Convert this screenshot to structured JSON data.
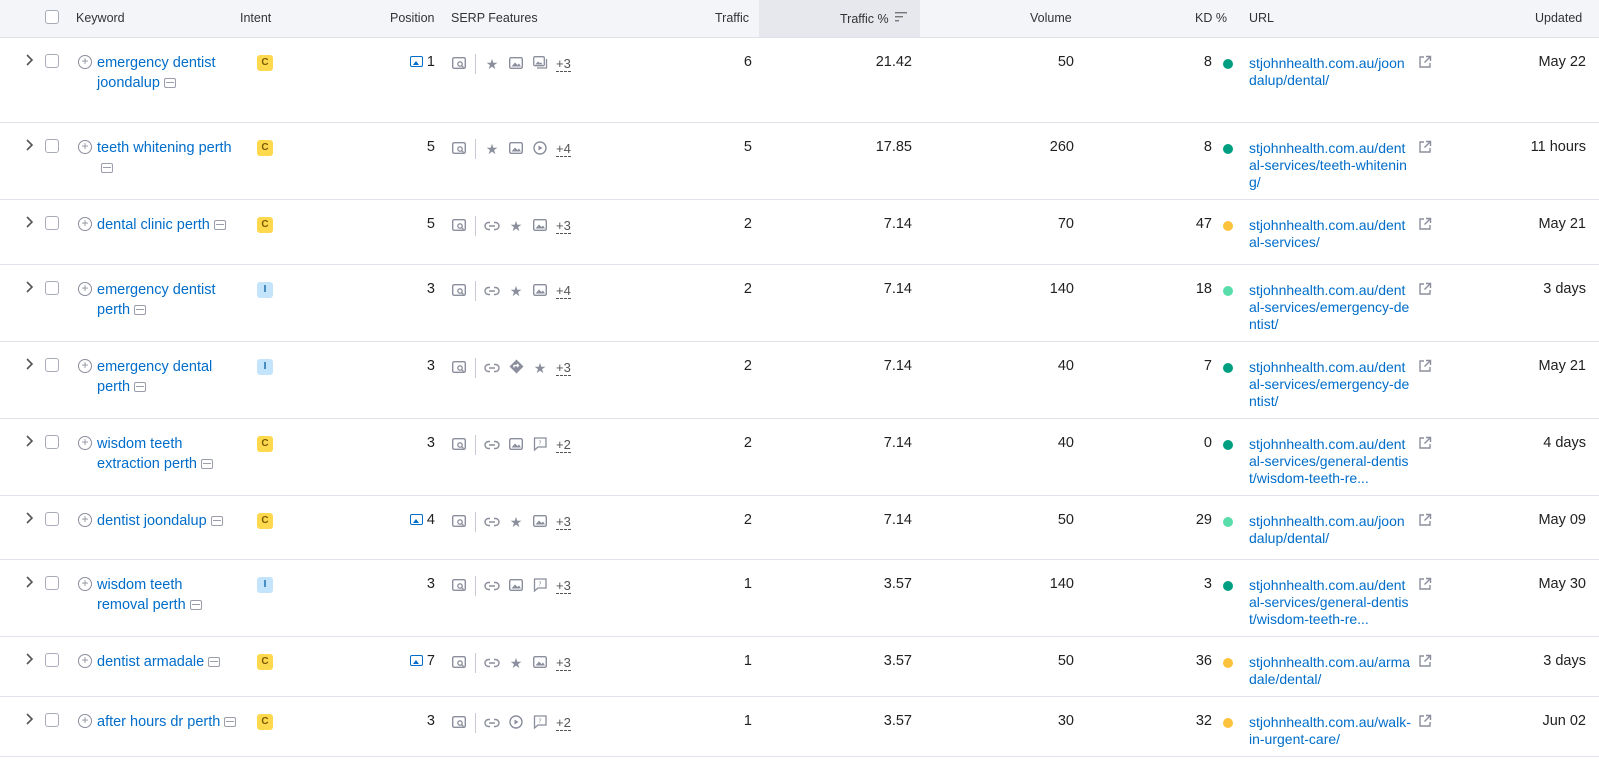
{
  "headers": {
    "keyword": "Keyword",
    "intent": "Intent",
    "position": "Position",
    "serp_features": "SERP Features",
    "traffic": "Traffic",
    "traffic_pct": "Traffic %",
    "volume": "Volume",
    "kd": "KD %",
    "url": "URL",
    "updated": "Updated"
  },
  "rows": [
    {
      "keyword": "emergency dentist joondalup",
      "intent": "C",
      "position_icon": true,
      "position": "1",
      "features": [
        "serp-snippet-icon",
        "star-icon",
        "image-icon",
        "image-pack-icon"
      ],
      "more": "+3",
      "traffic": "6",
      "traffic_pct": "21.42",
      "volume": "50",
      "kd": "8",
      "kd_color": "#009f81",
      "url": "stjohnhealth.com.au/joondalup/dental/",
      "updated": "May 22"
    },
    {
      "keyword": "teeth whitening perth",
      "intent": "C",
      "position_icon": false,
      "position": "5",
      "features": [
        "serp-snippet-icon",
        "star-icon",
        "image-icon",
        "video-icon"
      ],
      "more": "+4",
      "traffic": "5",
      "traffic_pct": "17.85",
      "volume": "260",
      "kd": "8",
      "kd_color": "#009f81",
      "url": "stjohnhealth.com.au/dental-services/teeth-whitening/",
      "updated": "11 hours"
    },
    {
      "keyword": "dental clinic perth",
      "intent": "C",
      "position_icon": false,
      "position": "5",
      "features": [
        "serp-snippet-icon",
        "link-icon",
        "star-icon",
        "image-icon"
      ],
      "more": "+3",
      "traffic": "2",
      "traffic_pct": "7.14",
      "volume": "70",
      "kd": "47",
      "kd_color": "#fdc23c",
      "url": "stjohnhealth.com.au/dental-services/",
      "updated": "May 21"
    },
    {
      "keyword": "emergency dentist perth",
      "intent": "I",
      "position_icon": false,
      "position": "3",
      "features": [
        "serp-snippet-icon",
        "link-icon",
        "star-icon",
        "image-icon"
      ],
      "more": "+4",
      "traffic": "2",
      "traffic_pct": "7.14",
      "volume": "140",
      "kd": "18",
      "kd_color": "#59ddaa",
      "url": "stjohnhealth.com.au/dental-services/emergency-dentist/",
      "updated": "3 days"
    },
    {
      "keyword": "emergency dental perth",
      "intent": "I",
      "position_icon": false,
      "position": "3",
      "features": [
        "serp-snippet-icon",
        "link-icon",
        "local-pack-icon",
        "star-icon"
      ],
      "more": "+3",
      "traffic": "2",
      "traffic_pct": "7.14",
      "volume": "40",
      "kd": "7",
      "kd_color": "#009f81",
      "url": "stjohnhealth.com.au/dental-services/emergency-dentist/",
      "updated": "May 21"
    },
    {
      "keyword": "wisdom teeth extraction perth",
      "intent": "C",
      "position_icon": false,
      "position": "3",
      "features": [
        "serp-snippet-icon",
        "link-icon",
        "image-icon",
        "faq-icon"
      ],
      "more": "+2",
      "traffic": "2",
      "traffic_pct": "7.14",
      "volume": "40",
      "kd": "0",
      "kd_color": "#009f81",
      "url": "stjohnhealth.com.au/dental-services/general-dentist/wisdom-teeth-re...",
      "updated": "4 days"
    },
    {
      "keyword": "dentist joondalup",
      "intent": "C",
      "position_icon": true,
      "position": "4",
      "features": [
        "serp-snippet-icon",
        "link-icon",
        "star-icon",
        "image-icon"
      ],
      "more": "+3",
      "traffic": "2",
      "traffic_pct": "7.14",
      "volume": "50",
      "kd": "29",
      "kd_color": "#59ddaa",
      "url": "stjohnhealth.com.au/joondalup/dental/",
      "updated": "May 09"
    },
    {
      "keyword": "wisdom teeth removal perth",
      "intent": "I",
      "position_icon": false,
      "position": "3",
      "features": [
        "serp-snippet-icon",
        "link-icon",
        "image-icon",
        "faq-icon"
      ],
      "more": "+3",
      "traffic": "1",
      "traffic_pct": "3.57",
      "volume": "140",
      "kd": "3",
      "kd_color": "#009f81",
      "url": "stjohnhealth.com.au/dental-services/general-dentist/wisdom-teeth-re...",
      "updated": "May 30"
    },
    {
      "keyword": "dentist armadale",
      "intent": "C",
      "position_icon": true,
      "position": "7",
      "features": [
        "serp-snippet-icon",
        "link-icon",
        "star-icon",
        "image-icon"
      ],
      "more": "+3",
      "traffic": "1",
      "traffic_pct": "3.57",
      "volume": "50",
      "kd": "36",
      "kd_color": "#fdc23c",
      "url": "stjohnhealth.com.au/armadale/dental/",
      "updated": "3 days"
    },
    {
      "keyword": "after hours dr perth",
      "intent": "C",
      "position_icon": false,
      "position": "3",
      "features": [
        "serp-snippet-icon",
        "link-icon",
        "video-icon",
        "faq-icon"
      ],
      "more": "+2",
      "traffic": "1",
      "traffic_pct": "3.57",
      "volume": "30",
      "kd": "32",
      "kd_color": "#fdc23c",
      "url": "stjohnhealth.com.au/walk-in-urgent-care/",
      "updated": "Jun 02"
    }
  ]
}
